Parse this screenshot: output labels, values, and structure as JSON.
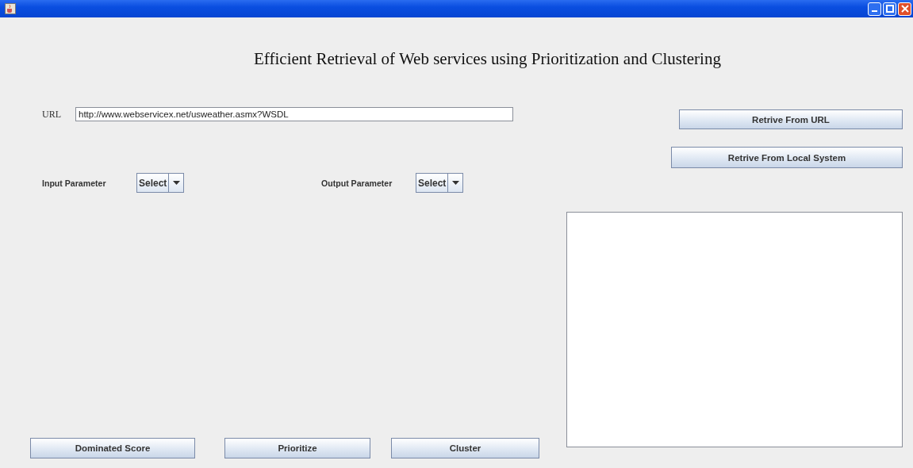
{
  "heading": "Efficient Retrieval of Web services using Prioritization and Clustering",
  "url": {
    "label": "URL",
    "value": "http://www.webservicex.net/usweather.asmx?WSDL"
  },
  "right_buttons": [
    "Retrive From URL",
    "Retrive From Local System"
  ],
  "input_parameter": {
    "label": "Input Parameter",
    "value": "Select"
  },
  "output_parameter": {
    "label": "Output Parameter",
    "value": "Select"
  },
  "bottom_buttons": [
    "Dominated Score",
    "Prioritize",
    "Cluster"
  ]
}
